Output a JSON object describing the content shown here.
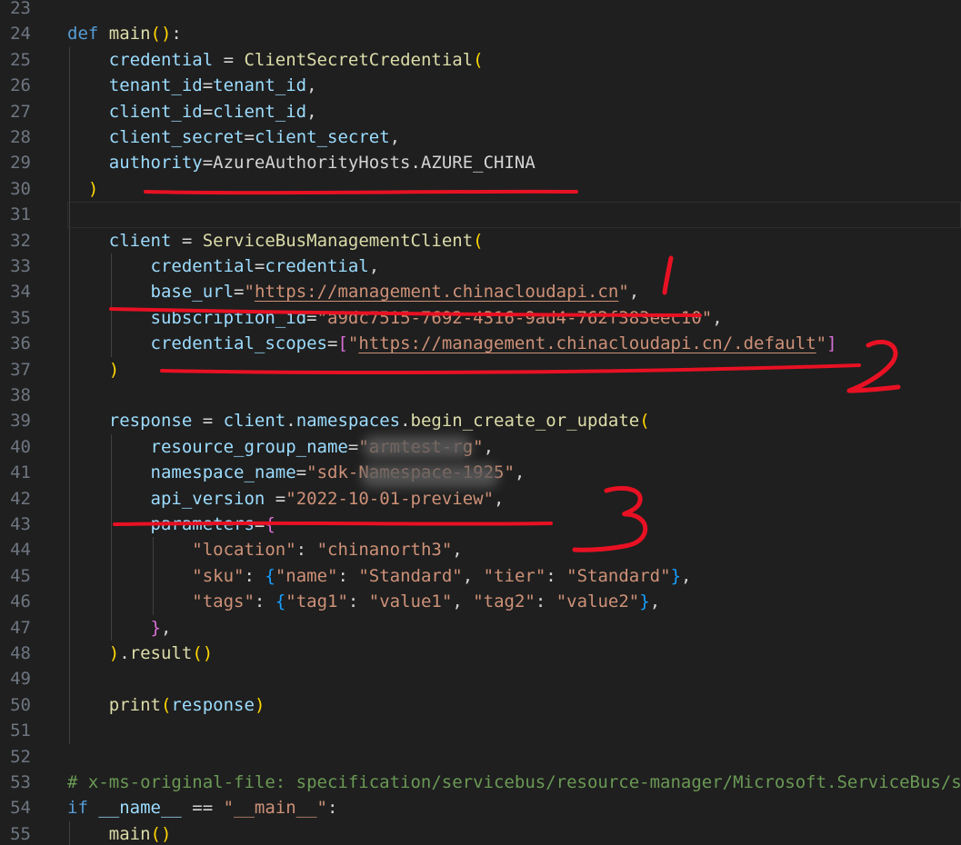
{
  "theme": {
    "background": "#1f1f1f",
    "colors": {
      "kw": "#569cd6",
      "fn": "#dcdcaa",
      "var": "#9cdcfe",
      "str": "#ce9178",
      "cmt": "#6a9955",
      "p1": "#ffd700",
      "p2": "#da70d6",
      "p3": "#179fff",
      "op": "#d4d4d4",
      "lineNumber": "#6e7681",
      "annotation": "#e81123"
    }
  },
  "editor": {
    "current_line": 31,
    "lines": [
      {
        "n": "23",
        "tokens": []
      },
      {
        "n": "24",
        "tokens": [
          [
            "kw",
            "def "
          ],
          [
            "fn",
            "main"
          ],
          [
            "p1",
            "()"
          ],
          [
            "op",
            ":"
          ]
        ]
      },
      {
        "n": "25",
        "tokens": [
          [
            "op",
            "    "
          ],
          [
            "var",
            "credential"
          ],
          [
            "op",
            " = "
          ],
          [
            "fn",
            "ClientSecretCredential"
          ],
          [
            "p1",
            "("
          ]
        ]
      },
      {
        "n": "26",
        "tokens": [
          [
            "op",
            "    "
          ],
          [
            "var",
            "tenant_id"
          ],
          [
            "op",
            "="
          ],
          [
            "var",
            "tenant_id"
          ],
          [
            "op",
            ","
          ]
        ]
      },
      {
        "n": "27",
        "tokens": [
          [
            "op",
            "    "
          ],
          [
            "var",
            "client_id"
          ],
          [
            "op",
            "="
          ],
          [
            "var",
            "client_id"
          ],
          [
            "op",
            ","
          ]
        ]
      },
      {
        "n": "28",
        "tokens": [
          [
            "op",
            "    "
          ],
          [
            "var",
            "client_secret"
          ],
          [
            "op",
            "="
          ],
          [
            "var",
            "client_secret"
          ],
          [
            "op",
            ","
          ]
        ]
      },
      {
        "n": "29",
        "tokens": [
          [
            "op",
            "    "
          ],
          [
            "var",
            "authority"
          ],
          [
            "op",
            "=AzureAuthorityHosts.AZURE_CHINA"
          ]
        ]
      },
      {
        "n": "30",
        "tokens": [
          [
            "op",
            "  "
          ],
          [
            "p1",
            ")"
          ]
        ]
      },
      {
        "n": "31",
        "tokens": []
      },
      {
        "n": "32",
        "tokens": [
          [
            "op",
            "    "
          ],
          [
            "var",
            "client"
          ],
          [
            "op",
            " = "
          ],
          [
            "fn",
            "ServiceBusManagementClient"
          ],
          [
            "p1",
            "("
          ]
        ]
      },
      {
        "n": "33",
        "tokens": [
          [
            "op",
            "        "
          ],
          [
            "var",
            "credential"
          ],
          [
            "op",
            "="
          ],
          [
            "var",
            "credential"
          ],
          [
            "op",
            ","
          ]
        ]
      },
      {
        "n": "34",
        "tokens": [
          [
            "op",
            "        "
          ],
          [
            "var",
            "base_url"
          ],
          [
            "op",
            "="
          ],
          [
            "str",
            "\""
          ],
          [
            "stru",
            "https://management.chinacloudapi.cn"
          ],
          [
            "str",
            "\""
          ],
          [
            "op",
            ","
          ]
        ]
      },
      {
        "n": "35",
        "tokens": [
          [
            "op",
            "        "
          ],
          [
            "var",
            "subscription_id"
          ],
          [
            "op",
            "="
          ],
          [
            "str",
            "\"a9dc7515-7692-4316-9ad4-762f383eec10\""
          ],
          [
            "op",
            ","
          ]
        ]
      },
      {
        "n": "36",
        "tokens": [
          [
            "op",
            "        "
          ],
          [
            "var",
            "credential_scopes"
          ],
          [
            "op",
            "="
          ],
          [
            "p2",
            "["
          ],
          [
            "str",
            "\""
          ],
          [
            "stru",
            "https://management.chinacloudapi.cn/.default"
          ],
          [
            "str",
            "\""
          ],
          [
            "p2",
            "]"
          ]
        ]
      },
      {
        "n": "37",
        "tokens": [
          [
            "op",
            "    "
          ],
          [
            "p1",
            ")"
          ]
        ]
      },
      {
        "n": "38",
        "tokens": []
      },
      {
        "n": "39",
        "tokens": [
          [
            "op",
            "    "
          ],
          [
            "var",
            "response"
          ],
          [
            "op",
            " = "
          ],
          [
            "var",
            "client"
          ],
          [
            "op",
            "."
          ],
          [
            "var",
            "namespaces"
          ],
          [
            "op",
            "."
          ],
          [
            "fn",
            "begin_create_or_update"
          ],
          [
            "p1",
            "("
          ]
        ]
      },
      {
        "n": "40",
        "tokens": [
          [
            "op",
            "        "
          ],
          [
            "var",
            "resource_group_name"
          ],
          [
            "op",
            "="
          ],
          [
            "str",
            "\"armtest-rg\""
          ],
          [
            "op",
            ","
          ]
        ]
      },
      {
        "n": "41",
        "tokens": [
          [
            "op",
            "        "
          ],
          [
            "var",
            "namespace_name"
          ],
          [
            "op",
            "="
          ],
          [
            "str",
            "\"sdk-Namespace-1925\""
          ],
          [
            "op",
            ","
          ]
        ]
      },
      {
        "n": "42",
        "tokens": [
          [
            "op",
            "        "
          ],
          [
            "var",
            "api_version"
          ],
          [
            "op",
            " ="
          ],
          [
            "str",
            "\"2022-10-01-preview\""
          ],
          [
            "op",
            ","
          ]
        ]
      },
      {
        "n": "43",
        "tokens": [
          [
            "op",
            "        "
          ],
          [
            "var",
            "parameters"
          ],
          [
            "op",
            "="
          ],
          [
            "p2",
            "{"
          ]
        ]
      },
      {
        "n": "44",
        "tokens": [
          [
            "op",
            "            "
          ],
          [
            "str",
            "\"location\""
          ],
          [
            "op",
            ": "
          ],
          [
            "str",
            "\"chinanorth3\""
          ],
          [
            "op",
            ","
          ]
        ]
      },
      {
        "n": "45",
        "tokens": [
          [
            "op",
            "            "
          ],
          [
            "str",
            "\"sku\""
          ],
          [
            "op",
            ": "
          ],
          [
            "p3",
            "{"
          ],
          [
            "str",
            "\"name\""
          ],
          [
            "op",
            ": "
          ],
          [
            "str",
            "\"Standard\""
          ],
          [
            "op",
            ", "
          ],
          [
            "str",
            "\"tier\""
          ],
          [
            "op",
            ": "
          ],
          [
            "str",
            "\"Standard\""
          ],
          [
            "p3",
            "}"
          ],
          [
            "op",
            ","
          ]
        ]
      },
      {
        "n": "46",
        "tokens": [
          [
            "op",
            "            "
          ],
          [
            "str",
            "\"tags\""
          ],
          [
            "op",
            ": "
          ],
          [
            "p3",
            "{"
          ],
          [
            "str",
            "\"tag1\""
          ],
          [
            "op",
            ": "
          ],
          [
            "str",
            "\"value1\""
          ],
          [
            "op",
            ", "
          ],
          [
            "str",
            "\"tag2\""
          ],
          [
            "op",
            ": "
          ],
          [
            "str",
            "\"value2\""
          ],
          [
            "p3",
            "}"
          ],
          [
            "op",
            ","
          ]
        ]
      },
      {
        "n": "47",
        "tokens": [
          [
            "op",
            "        "
          ],
          [
            "p2",
            "}"
          ],
          [
            "op",
            ","
          ]
        ]
      },
      {
        "n": "48",
        "tokens": [
          [
            "op",
            "    "
          ],
          [
            "p1",
            ")"
          ],
          [
            "op",
            "."
          ],
          [
            "fn",
            "result"
          ],
          [
            "p1",
            "()"
          ]
        ]
      },
      {
        "n": "49",
        "tokens": []
      },
      {
        "n": "50",
        "tokens": [
          [
            "op",
            "    "
          ],
          [
            "fn",
            "print"
          ],
          [
            "p1",
            "("
          ],
          [
            "var",
            "response"
          ],
          [
            "p1",
            ")"
          ]
        ]
      },
      {
        "n": "51",
        "tokens": []
      },
      {
        "n": "52",
        "tokens": []
      },
      {
        "n": "53",
        "tokens": [
          [
            "cmt",
            "# x-ms-original-file: specification/servicebus/resource-manager/Microsoft.ServiceBus/s"
          ]
        ]
      },
      {
        "n": "54",
        "tokens": [
          [
            "kw",
            "if "
          ],
          [
            "var",
            "__name__"
          ],
          [
            "op",
            " == "
          ],
          [
            "str",
            "\"__main__\""
          ],
          [
            "op",
            ":"
          ]
        ]
      },
      {
        "n": "55",
        "tokens": [
          [
            "op",
            "    "
          ],
          [
            "fn",
            "main"
          ],
          [
            "p1",
            "()"
          ]
        ]
      }
    ]
  },
  "annotations": {
    "labels": [
      "1",
      "2",
      "3"
    ]
  }
}
